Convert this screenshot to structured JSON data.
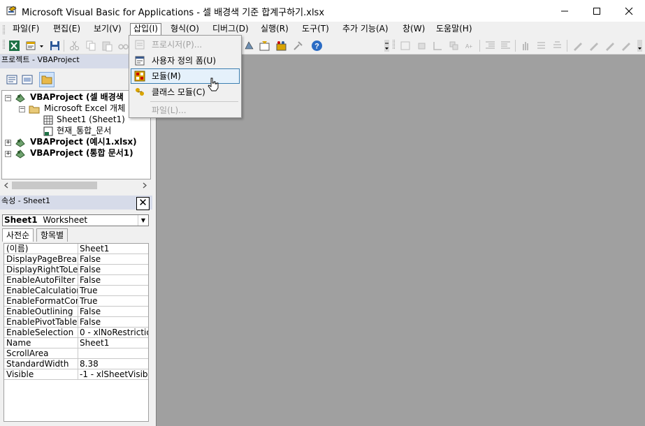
{
  "window": {
    "title": "Microsoft Visual Basic for Applications - 셀 배경색 기준 합계구하기.xlsx",
    "minimize_label": "—",
    "maximize_label": "☐",
    "close_label": "✕"
  },
  "menubar": {
    "items": [
      {
        "label": "파일(F)"
      },
      {
        "label": "편집(E)"
      },
      {
        "label": "보기(V)"
      },
      {
        "label": "삽입(I)"
      },
      {
        "label": "형식(O)"
      },
      {
        "label": "디버그(D)"
      },
      {
        "label": "실행(R)"
      },
      {
        "label": "도구(T)"
      },
      {
        "label": "추가 기능(A)"
      },
      {
        "label": "창(W)"
      },
      {
        "label": "도움말(H)"
      }
    ]
  },
  "insert_menu": {
    "items": [
      {
        "label": "프로시저(P)...",
        "icon": "procedure-icon",
        "disabled": true
      },
      {
        "label": "사용자 정의 폼(U)",
        "icon": "userform-icon",
        "disabled": false
      },
      {
        "label": "모듈(M)",
        "icon": "module-icon",
        "disabled": false
      },
      {
        "label": "클래스 모듈(C)",
        "icon": "class-module-icon",
        "disabled": false
      },
      {
        "label": "파일(L)...",
        "icon": "",
        "disabled": true
      }
    ]
  },
  "project_panel": {
    "title": "프로젝트 - VBAProject",
    "tree": [
      {
        "label": "VBAProject (셀 배경색"
      },
      {
        "label": "Microsoft Excel 개체"
      },
      {
        "label": "Sheet1 (Sheet1)"
      },
      {
        "label": "현재_통합_문서"
      },
      {
        "label": "VBAProject (예시1.xlsx)"
      },
      {
        "label": "VBAProject (통합 문서1)"
      }
    ]
  },
  "properties_panel": {
    "title": "속성 - Sheet1",
    "object_name": "Sheet1",
    "object_type": "Worksheet",
    "tabs": [
      {
        "label": "사전순"
      },
      {
        "label": "항목별"
      }
    ],
    "rows": [
      {
        "name": "(이름)",
        "value": "Sheet1"
      },
      {
        "name": "DisplayPageBreak",
        "value": "False"
      },
      {
        "name": "DisplayRightToLef",
        "value": "False"
      },
      {
        "name": "EnableAutoFilter",
        "value": "False"
      },
      {
        "name": "EnableCalculation",
        "value": "True"
      },
      {
        "name": "EnableFormatCon",
        "value": "True"
      },
      {
        "name": "EnableOutlining",
        "value": "False"
      },
      {
        "name": "EnablePivotTable",
        "value": "False"
      },
      {
        "name": "EnableSelection",
        "value": "0 - xlNoRestrictio"
      },
      {
        "name": "Name",
        "value": "Sheet1"
      },
      {
        "name": "ScrollArea",
        "value": ""
      },
      {
        "name": "StandardWidth",
        "value": "8.38"
      },
      {
        "name": "Visible",
        "value": "-1 - xlSheetVisib"
      }
    ]
  },
  "colors": {
    "panel_title_bg": "#d6dbe9",
    "workspace_bg": "#a0a0a0",
    "menu_hover": "#e5f1fb",
    "menu_hover_border": "#3c7fb1"
  }
}
